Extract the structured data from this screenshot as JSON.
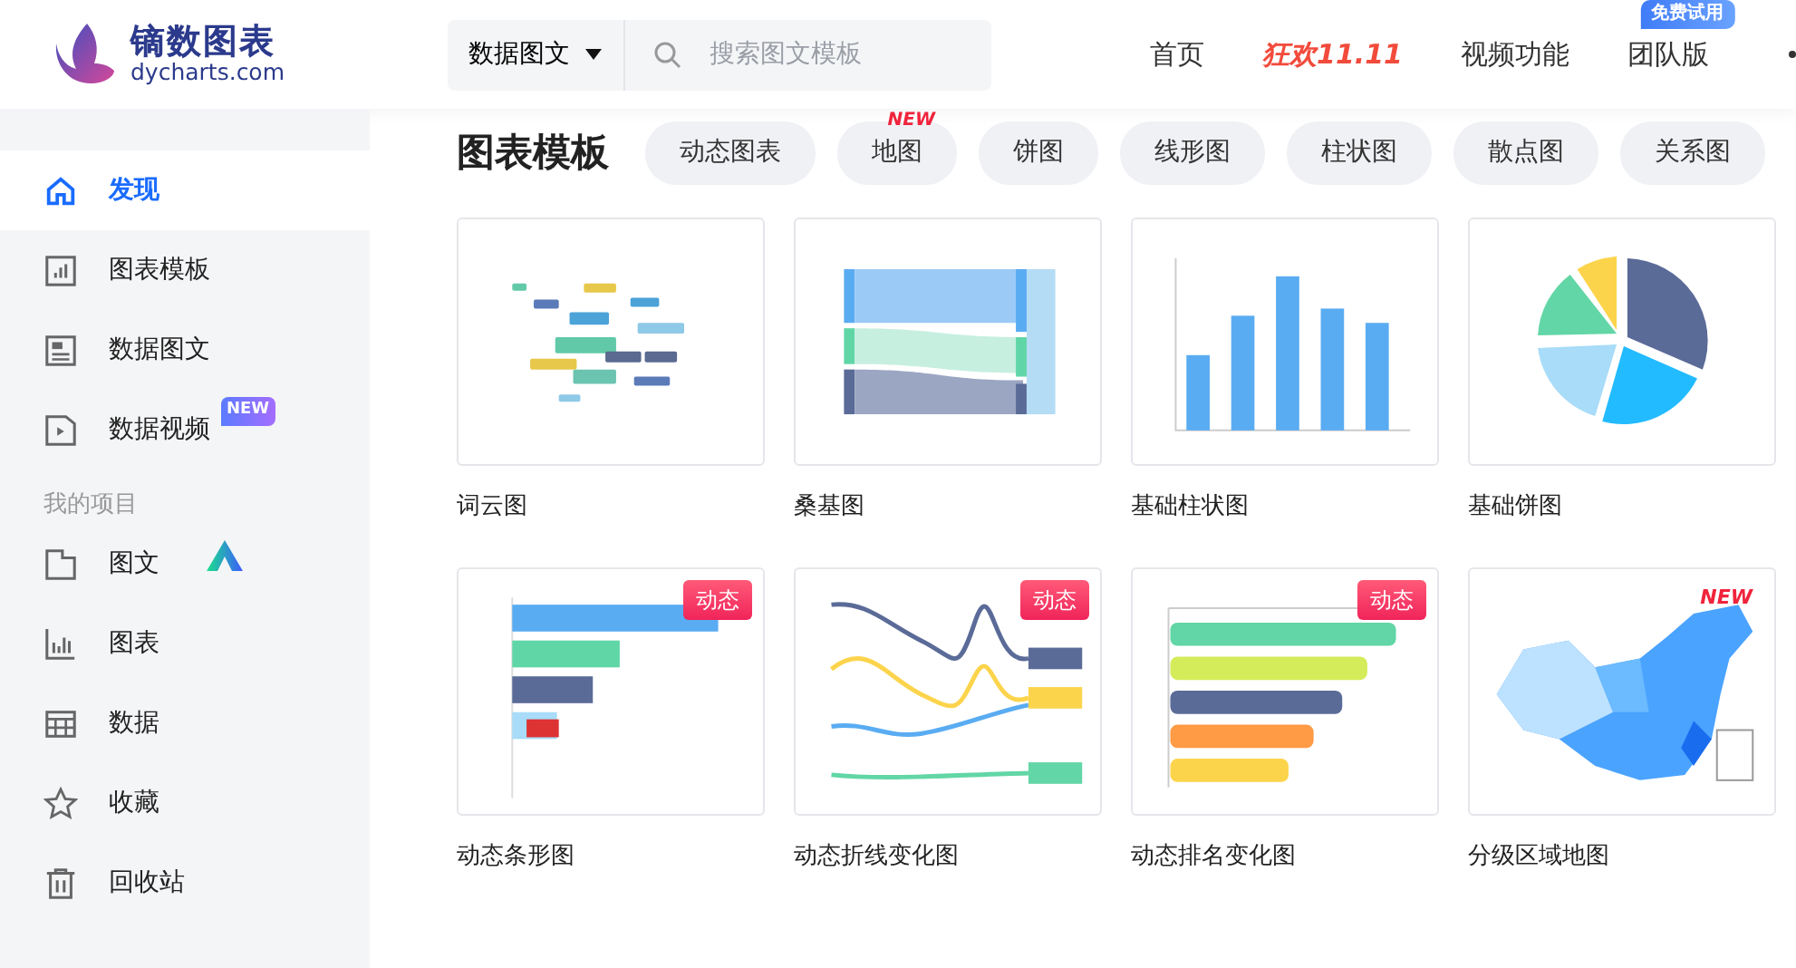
{
  "logo": {
    "name": "镝数图表",
    "domain": "dycharts.com"
  },
  "search": {
    "scope": "数据图文",
    "placeholder": "搜索图文模板"
  },
  "nav": [
    {
      "label": "首页",
      "kind": "plain"
    },
    {
      "label": "狂欢11.11",
      "kind": "promo"
    },
    {
      "label": "视频功能",
      "kind": "plain"
    },
    {
      "label": "团队版",
      "kind": "plain",
      "badge": "免费试用"
    }
  ],
  "sidebar": {
    "items": [
      {
        "label": "发现",
        "selected": true
      },
      {
        "label": "图表模板",
        "selected": false
      },
      {
        "label": "数据图文",
        "selected": false
      },
      {
        "label": "数据视频",
        "selected": false,
        "badge": "NEW"
      }
    ],
    "section_title": "我的项目",
    "project_items": [
      {
        "label": "图文",
        "selected": false
      },
      {
        "label": "图表",
        "selected": false
      },
      {
        "label": "数据",
        "selected": false
      },
      {
        "label": "收藏",
        "selected": false
      },
      {
        "label": "回收站",
        "selected": false
      }
    ]
  },
  "page_title": "图表模板",
  "filters": [
    {
      "label": "动态图表"
    },
    {
      "label": "地图",
      "badge": "NEW"
    },
    {
      "label": "饼图"
    },
    {
      "label": "线形图"
    },
    {
      "label": "柱状图"
    },
    {
      "label": "散点图"
    },
    {
      "label": "关系图"
    }
  ],
  "templates": [
    {
      "title": "词云图"
    },
    {
      "title": "桑基图"
    },
    {
      "title": "基础柱状图"
    },
    {
      "title": "基础饼图"
    },
    {
      "title": "动态条形图",
      "tag": "动态"
    },
    {
      "title": "动态折线变化图",
      "tag": "动态"
    },
    {
      "title": "动态排名变化图",
      "tag": "动态"
    },
    {
      "title": "分级区域地图",
      "badge": "NEW"
    }
  ]
}
